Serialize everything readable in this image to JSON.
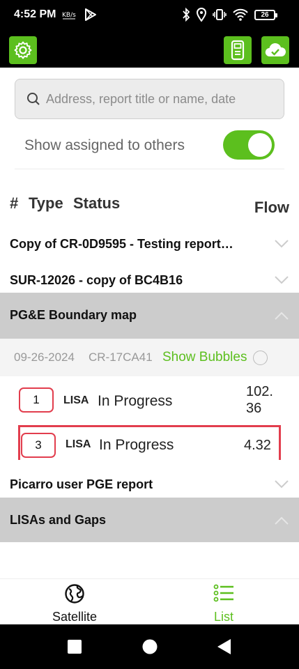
{
  "status_bar": {
    "time": "4:52 PM",
    "battery": "26",
    "icons": [
      "network-speed-icon",
      "play-store-icon",
      "bluetooth-icon",
      "location-icon",
      "vibrate-icon",
      "wifi-icon",
      "battery-icon"
    ]
  },
  "app_bar": {
    "left_icon": "gear-icon",
    "right_icons": [
      "device-icon",
      "cloud-check-icon"
    ],
    "accent_color": "#5cbf1e"
  },
  "search": {
    "placeholder": "Address, report title or name, date"
  },
  "toggle": {
    "label": "Show assigned to others",
    "on": true
  },
  "columns": {
    "hash": "#",
    "type": "Type",
    "status": "Status",
    "flow": "Flow"
  },
  "reports": [
    {
      "title": "Copy of CR-0D9595 - Testing report…",
      "expanded": false
    },
    {
      "title": "SUR-12026 - copy of BC4B16",
      "expanded": false
    },
    {
      "title": "PG&E Boundary map",
      "expanded": true,
      "date": "09-26-2024",
      "code": "CR-17CA41",
      "bubbles_label": "Show Bubbles",
      "lisas": [
        {
          "id": "1",
          "type": "LISA",
          "status": "In Progress",
          "flow_line1": "102.",
          "flow_line2": "36"
        },
        {
          "id": "3",
          "type": "LISA",
          "status": "In Progress",
          "flow_line1": "4.32",
          "flow_line2": ""
        }
      ]
    },
    {
      "title": "Picarro user PGE report",
      "expanded": false
    },
    {
      "title": "LISAs and Gaps",
      "expanded": true
    }
  ],
  "tabs": [
    {
      "label": "Satellite",
      "icon": "globe-icon",
      "active": false
    },
    {
      "label": "List",
      "icon": "list-icon",
      "active": true
    }
  ],
  "nav_buttons": [
    "recents-square-icon",
    "home-circle-icon",
    "back-triangle-icon"
  ]
}
